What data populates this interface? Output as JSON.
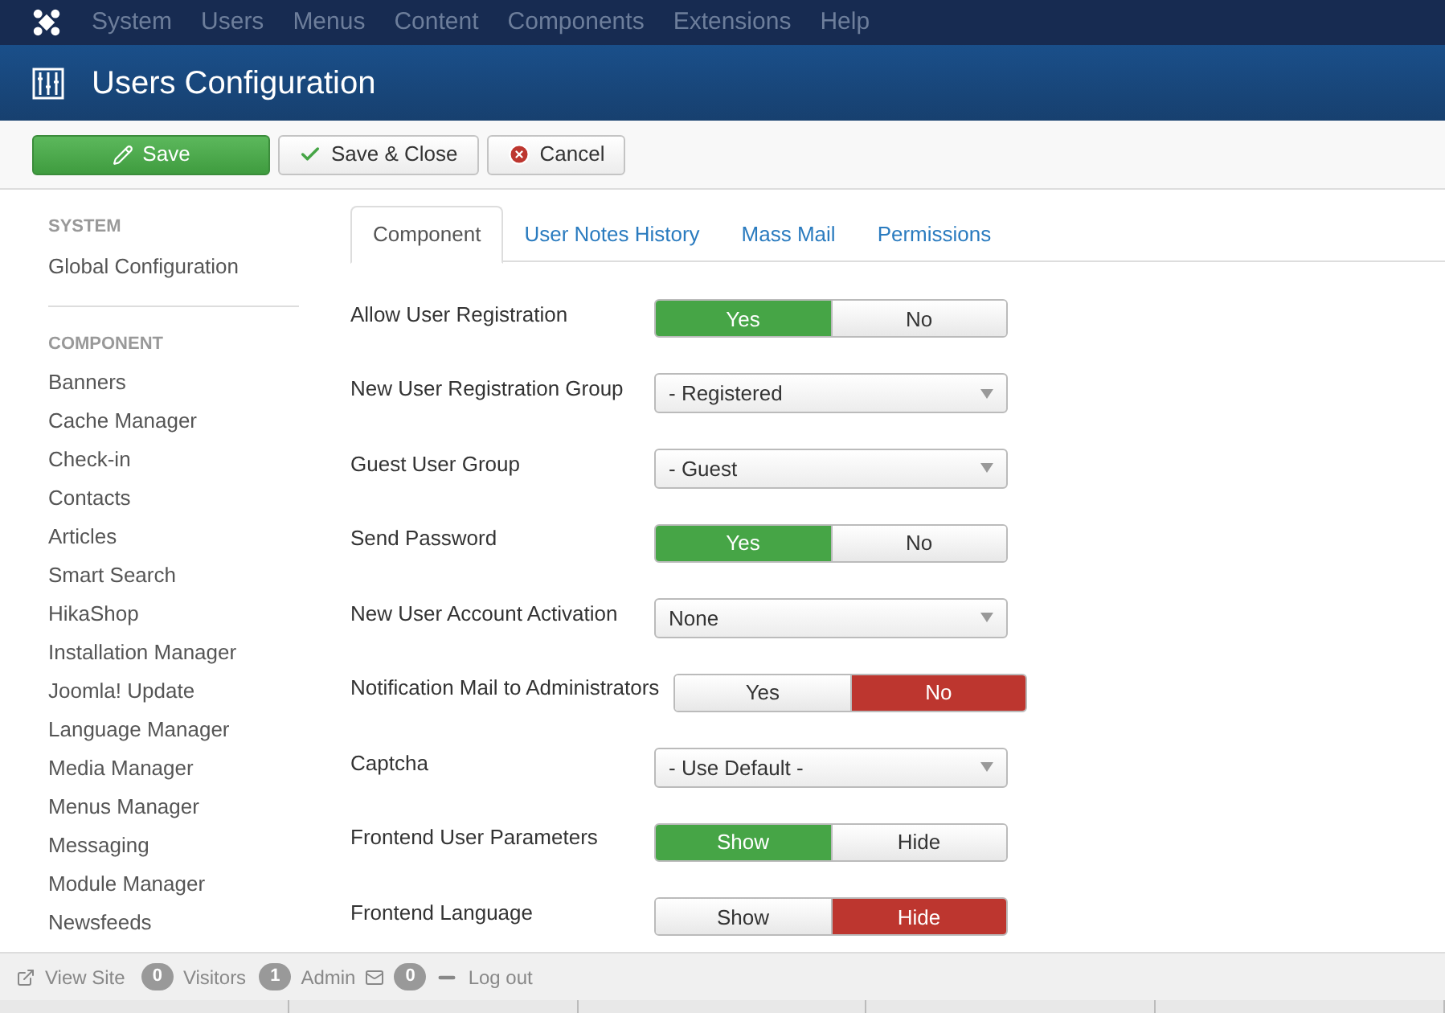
{
  "menu": [
    "System",
    "Users",
    "Menus",
    "Content",
    "Components",
    "Extensions",
    "Help"
  ],
  "header": {
    "title": "Users Configuration"
  },
  "toolbar": [
    {
      "label": "Save",
      "kind": "primary"
    },
    {
      "label": "Save & Close",
      "kind": "check"
    },
    {
      "label": "Cancel",
      "kind": "cancel"
    }
  ],
  "sidebar": {
    "sections": [
      {
        "heading": "SYSTEM",
        "items": [
          "Global Configuration"
        ]
      },
      {
        "heading": "COMPONENT",
        "items": [
          "Banners",
          "Cache Manager",
          "Check-in",
          "Contacts",
          "Articles",
          "Smart Search",
          "HikaShop",
          "Installation Manager",
          "Joomla! Update",
          "Language Manager",
          "Media Manager",
          "Menus Manager",
          "Messaging",
          "Module Manager",
          "Newsfeeds"
        ]
      }
    ]
  },
  "tabs": [
    {
      "label": "Component",
      "selected": true
    },
    {
      "label": "User Notes History",
      "selected": false
    },
    {
      "label": "Mass Mail",
      "selected": false
    },
    {
      "label": "Permissions",
      "selected": false
    }
  ],
  "fields": [
    {
      "label": "Allow User Registration",
      "kind": "toggle",
      "options": [
        {
          "label": "Yes",
          "selected": true,
          "color": "#46a546"
        },
        {
          "label": "No",
          "selected": false
        }
      ]
    },
    {
      "label": "New User Registration Group",
      "kind": "select",
      "value": "- Registered"
    },
    {
      "label": "Guest User Group",
      "kind": "select",
      "value": "- Guest"
    },
    {
      "label": "Send Password",
      "kind": "toggle",
      "options": [
        {
          "label": "Yes",
          "selected": true,
          "color": "#46a546"
        },
        {
          "label": "No",
          "selected": false
        }
      ]
    },
    {
      "label": "New User Account Activation",
      "kind": "select",
      "value": "None"
    },
    {
      "label": "Notification Mail to Administrators",
      "kind": "toggle",
      "options": [
        {
          "label": "Yes",
          "selected": false
        },
        {
          "label": "No",
          "selected": true,
          "color": "#bd362f"
        }
      ]
    },
    {
      "label": "Captcha",
      "kind": "select",
      "value": "- Use Default -"
    },
    {
      "label": "Frontend User Parameters",
      "kind": "toggle",
      "options": [
        {
          "label": "Show",
          "selected": true,
          "color": "#46a546"
        },
        {
          "label": "Hide",
          "selected": false
        }
      ]
    },
    {
      "label": "Frontend Language",
      "kind": "toggle",
      "options": [
        {
          "label": "Show",
          "selected": false
        },
        {
          "label": "Hide",
          "selected": true,
          "color": "#bd362f"
        }
      ]
    }
  ],
  "status_bar": {
    "view_site": "View Site",
    "visitors_count": "0",
    "visitors": "Visitors",
    "admin_count": "1",
    "admin": "Admin",
    "messages_count": "0",
    "logout": "Log out"
  }
}
